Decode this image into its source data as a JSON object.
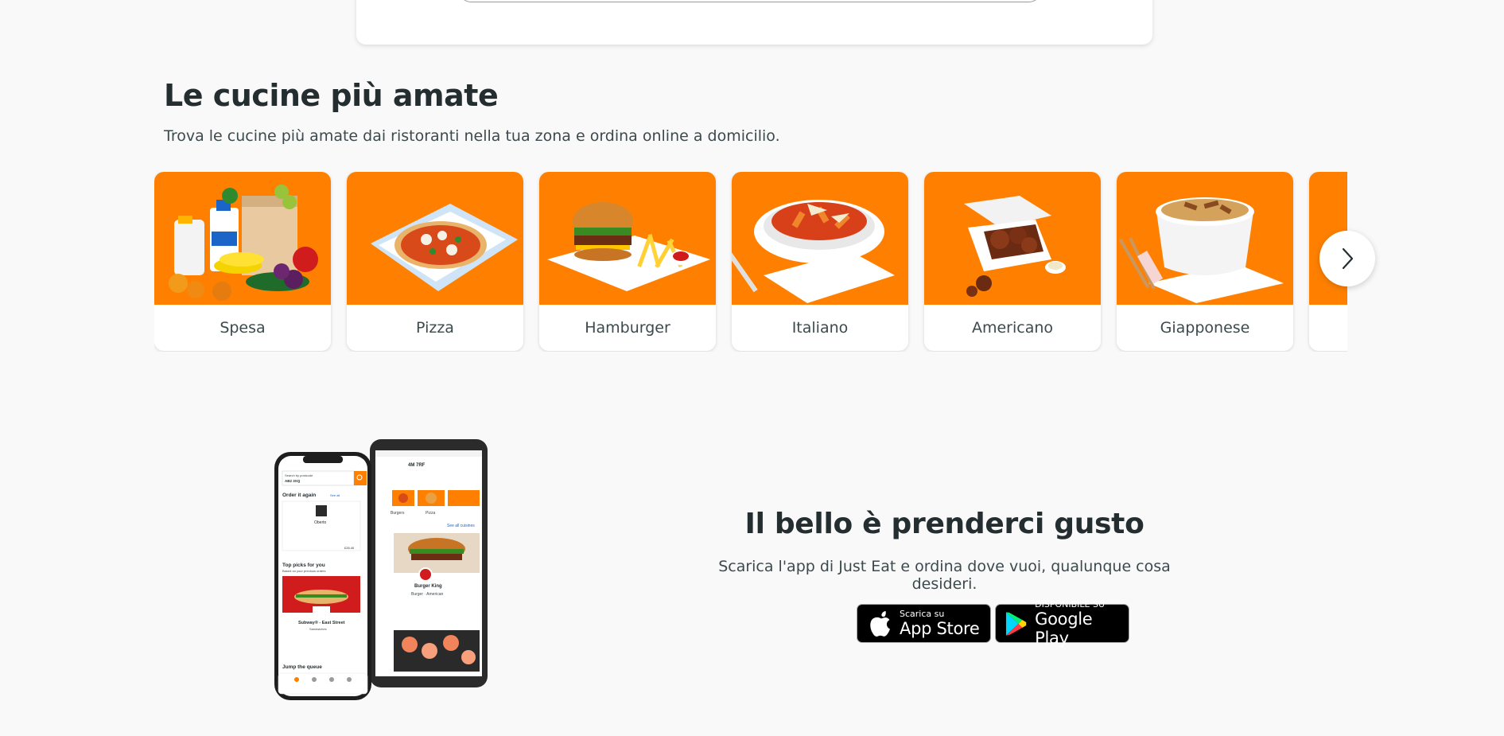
{
  "cuisines_section": {
    "title": "Le cucine più amate",
    "subtitle": "Trova le cucine più amate dai ristoranti nella tua zona e ordina online a domicilio.",
    "items": [
      {
        "label": "Spesa",
        "image": "groceries-bag"
      },
      {
        "label": "Pizza",
        "image": "pizza"
      },
      {
        "label": "Hamburger",
        "image": "burger-and-fries"
      },
      {
        "label": "Italiano",
        "image": "pasta-bowl"
      },
      {
        "label": "Americano",
        "image": "chicken-wings-box"
      },
      {
        "label": "Giapponese",
        "image": "poke-bowl"
      }
    ],
    "next_icon": "chevron-right-icon"
  },
  "app_promo": {
    "title": "Il bello è prenderci gusto",
    "subtitle": "Scarica l'app di Just Eat e ordina dove vuoi, qualunque cosa desideri.",
    "app_store": {
      "small": "Scarica su",
      "big": "App Store"
    },
    "google_play": {
      "small": "DISPONIBILE SU",
      "big": "Google Play"
    }
  },
  "phone_mock": {
    "search_label": "Search by postcode",
    "postcode": "AB2 3XQ",
    "order_again": "Order it again",
    "see_all": "See all",
    "restaurant_1": "Oberto",
    "price": "£26.40",
    "top_picks": "Top picks for you",
    "top_picks_sub": "Based on your previous orders",
    "subway": "Subway® - East Street",
    "subway_cat": "Sandwiches",
    "jump_queue": "Jump the queue",
    "android_location": "4M 7RF",
    "see_all_cuisines": "See all cuisines",
    "burger_king": "Burger King",
    "burger_king_cat": "Burger · American",
    "tab_burgers": "Burgers",
    "tab_pizza": "Pizza"
  },
  "colors": {
    "brand_orange": "#ff8000",
    "text_dark": "#242e30",
    "text_body": "#3c4a4d",
    "page_bg": "#f9f9f9"
  }
}
